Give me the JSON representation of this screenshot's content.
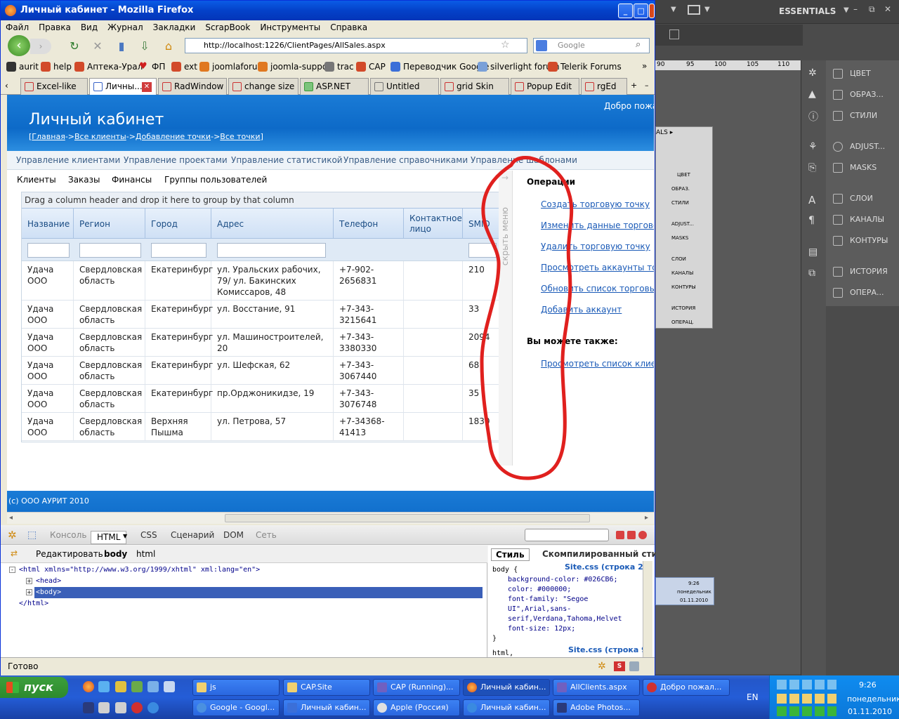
{
  "window": {
    "title": "Личный кабинет - Mozilla Firefox"
  },
  "menubar": [
    "Файл",
    "Правка",
    "Вид",
    "Журнал",
    "Закладки",
    "ScrapBook",
    "Инструменты",
    "Справка"
  ],
  "url": "http://localhost:1226/ClientPages/AllSales.aspx",
  "search_placeholder": "Google",
  "bookmarks": [
    "aurit",
    "help",
    "Аптека-Урал",
    "ФП",
    "ext",
    "joomlaforum",
    "joomla-support",
    "trac",
    "CAP",
    "Переводчик Google",
    "silverlight forum",
    "Telerik Forums"
  ],
  "tabs": [
    "Excel-like Au...",
    "Личны...",
    "RadWindow ...",
    "change size ...",
    "ASP.NET Gri...",
    "Untitled Page",
    "grid Skin He...",
    "Popup Edit F...",
    "rgEd"
  ],
  "page": {
    "title": "Личный кабинет",
    "welcome": "Добро пожал",
    "breadcrumb": [
      "Главная",
      "Все клиенты",
      "Добавление точки",
      "Все точки"
    ],
    "breadcrumb_sep": "->",
    "menu1": [
      "Управление клиентами",
      "Управление проектами",
      "Управление статистикой",
      "Управление справочниками",
      "Управление шаблонами"
    ],
    "menu2": [
      "Клиенты",
      "Заказы",
      "Финансы",
      "Группы пользователей"
    ],
    "group_hint": "Drag a column header and drop it here to group by that column",
    "columns": [
      "Название",
      "Регион",
      "Город",
      "Адрес",
      "Телефон",
      "Контактное лицо",
      "SMID"
    ],
    "rows": [
      [
        "Удача ООО",
        "Свердловская область",
        "Екатеринбург",
        "ул. Уральских рабочих, 79/ ул. Бакинских Комиссаров, 48",
        "+7-902-2656831",
        "",
        "210"
      ],
      [
        "Удача ООО",
        "Свердловская область",
        "Екатеринбург",
        "ул. Восстание, 91",
        "+7-343-3215641",
        "",
        "33"
      ],
      [
        "Удача ООО",
        "Свердловская область",
        "Екатеринбург",
        "ул. Машиностроителей, 20",
        "+7-343-3380330",
        "",
        "2094"
      ],
      [
        "Удача ООО",
        "Свердловская область",
        "Екатеринбург",
        "ул. Шефская, 62",
        "+7-343-3067440",
        "",
        "68"
      ],
      [
        "Удача ООО",
        "Свердловская область",
        "Екатеринбург",
        "пр.Орджоникидзе, 19",
        "+7-343-3076748",
        "",
        "35"
      ],
      [
        "Удача ООО",
        "Свердловская область",
        "Верхняя Пышма",
        "ул. Петрова, 57",
        "+7-34368-41413",
        "",
        "1830"
      ]
    ],
    "hide_menu": "скрыть меню",
    "ops_title": "Операции",
    "ops": [
      "Создать торговую точку",
      "Изменить данные торговой т",
      "Удалить торговую точку",
      "Просмотреть аккаунты торго",
      "Обновить список торговых т",
      "Добавить аккаунт"
    ],
    "also_title": "Вы можете также:",
    "also": [
      "Просмотреть список клиенто"
    ],
    "footer": "(c) ООО АУРИТ 2010"
  },
  "firebug": {
    "tabs": [
      "Консоль",
      "HTML",
      "CSS",
      "Сценарий",
      "DOM",
      "Сеть"
    ],
    "edit": "Редактировать",
    "crumb_body": "body",
    "crumb_html": "html",
    "tree": [
      "<html xmlns=\"http://www.w3.org/1999/xhtml\" xml:lang=\"en\">",
      "<head>",
      "<body>",
      "</html>"
    ],
    "right_tabs": [
      "Стиль",
      "Скомпилированный стиль"
    ],
    "css_source1": "Site.css (строка 26)",
    "css_selector": "body {",
    "css_lines": [
      "background-color: #026CB6;",
      "color: #000000;",
      "font-family: \"Segoe",
      "UI\",Arial,sans-",
      "serif,Verdana,Tahoma,Helvet",
      "font-size: 12px;"
    ],
    "css_close": "}",
    "css_source2": "Site.css (строка 9)",
    "css_next": "html,"
  },
  "status": "Готово",
  "photoshop": {
    "workspace": "ESSENTIALS",
    "ruler": [
      "90",
      "95",
      "100",
      "105",
      "110"
    ],
    "panel1": [
      "ЦВЕТ",
      "ОБРАЗ...",
      "СТИЛИ"
    ],
    "panel2": [
      "ADJUST...",
      "MASKS"
    ],
    "panel3": [
      "СЛОИ",
      "КАНАЛЫ",
      "КОНТУРЫ"
    ],
    "panel4": [
      "ИСТОРИЯ",
      "ОПЕРА..."
    ],
    "mini": [
      "ЦВЕТ",
      "ОБРАЗ.",
      "СТИЛИ",
      "ADJUST...",
      "MASKS",
      "СЛОИ",
      "КАНАЛЫ",
      "КОНТУРЫ",
      "ИСТОРИЯ",
      "ОПЕРАЦ."
    ],
    "mini_clock": [
      "9:26",
      "понедельник",
      "01.11.2010"
    ]
  },
  "taskbar": {
    "start": "пуск",
    "row1": [
      "js",
      "CAP.Site",
      "CAP (Running)...",
      "Личный кабин...",
      "AllClients.aspx",
      "Добро пожал..."
    ],
    "row2": [
      "Google - Googl...",
      "Личный кабин...",
      "Apple (Россия)",
      "Личный кабин...",
      "Adobe Photos..."
    ],
    "lang": "EN",
    "time": "9:26",
    "day": "понедельник",
    "date": "01.11.2010"
  },
  "colors": {
    "header_blue": "#0d6ac8",
    "link": "#1a5ab7",
    "annotation": "#e0201e"
  }
}
